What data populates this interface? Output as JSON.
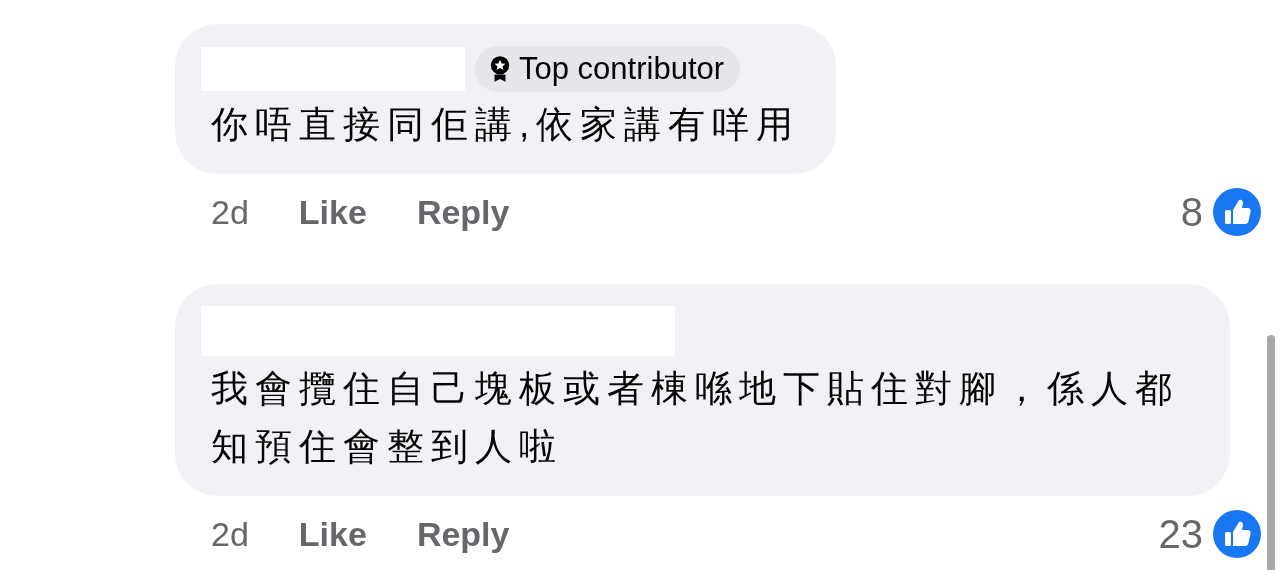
{
  "comments": [
    {
      "badge": "Top contributor",
      "text": "你唔直接同佢講,依家講有咩用",
      "time": "2d",
      "actions": [
        "Like",
        "Reply"
      ],
      "reaction_count": "8"
    },
    {
      "text": "我會攬住自己塊板或者棟喺地下貼住對腳，係人都知預住會整到人啦",
      "time": "2d",
      "actions": [
        "Like",
        "Reply"
      ],
      "reaction_count": "23"
    }
  ]
}
